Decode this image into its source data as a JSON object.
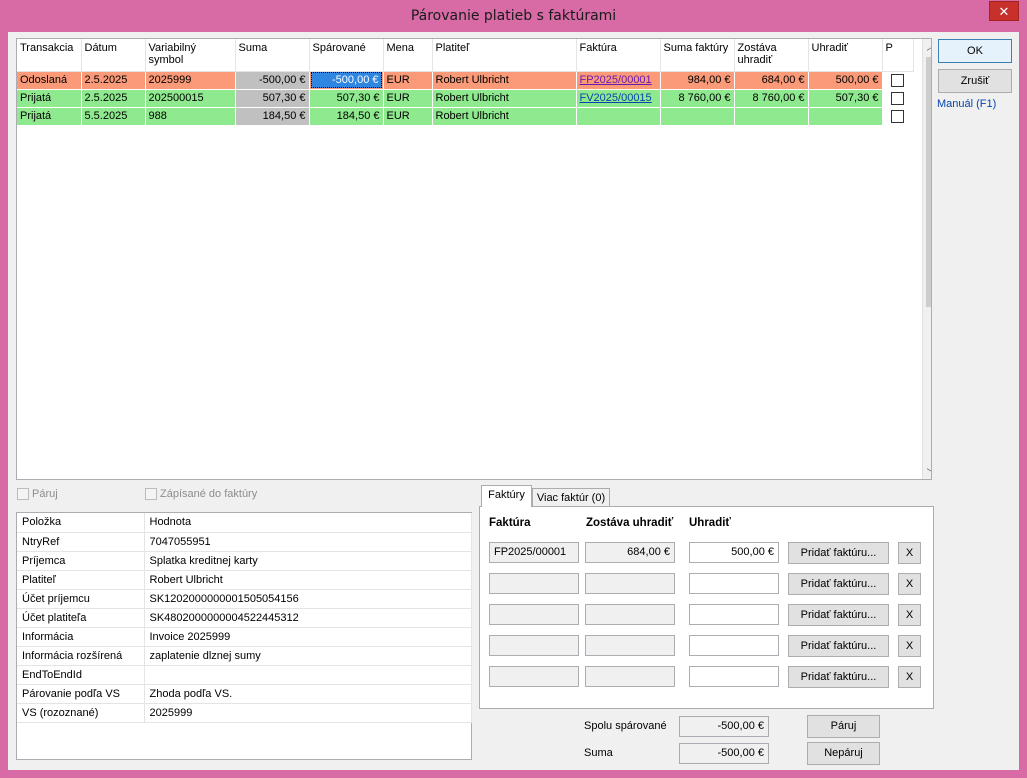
{
  "window": {
    "title": "Párovanie platieb s faktúrami",
    "close_glyph": "✕"
  },
  "grid": {
    "columns": [
      "Transakcia",
      "Dátum",
      "Variabilný symbol",
      "Suma",
      "Spárované",
      "Mena",
      "Platiteľ",
      "Faktúra",
      "Suma faktúry",
      "Zostáva uhradiť",
      "Uhradiť",
      "P"
    ],
    "rows": [
      {
        "type": "Odoslaná",
        "date": "2.5.2025",
        "vs": "2025999",
        "amount": "-500,00 €",
        "paired": "-500,00 €",
        "currency": "EUR",
        "payer": "Robert Ulbricht",
        "invoice": "FP2025/00001",
        "invoice_sum": "984,00 €",
        "remaining": "684,00 €",
        "pay": "500,00 €"
      },
      {
        "type": "Prijatá",
        "date": "2.5.2025",
        "vs": "202500015",
        "amount": "507,30 €",
        "paired": "507,30 €",
        "currency": "EUR",
        "payer": "Robert Ulbricht",
        "invoice": "FV2025/00015",
        "invoice_sum": "8 760,00 €",
        "remaining": "8 760,00 €",
        "pay": "507,30 €"
      },
      {
        "type": "Prijatá",
        "date": "5.5.2025",
        "vs": "988",
        "amount": "184,50 €",
        "paired": "184,50 €",
        "currency": "EUR",
        "payer": "Robert Ulbricht",
        "invoice": "",
        "invoice_sum": "",
        "remaining": "",
        "pay": ""
      }
    ]
  },
  "buttons": {
    "ok": "OK",
    "cancel": "Zrušiť",
    "manual": "Manuál (F1)"
  },
  "checks": {
    "pair": "Páruj",
    "written": "Zápísané do faktúry"
  },
  "details": {
    "headers": [
      "Položka",
      "Hodnota"
    ],
    "rows": [
      [
        "NtryRef",
        "7047055951"
      ],
      [
        "Príjemca",
        "Splatka kreditnej karty"
      ],
      [
        "Platiteľ",
        "Robert Ulbricht"
      ],
      [
        "Účet príjemcu",
        "SK1202000000001505054156"
      ],
      [
        "Účet platiteľa",
        "SK4802000000004522445312"
      ],
      [
        "Informácia",
        "Invoice 2025999"
      ],
      [
        "Informácia rozšírená",
        "zaplatenie dlznej sumy"
      ],
      [
        "EndToEndId",
        ""
      ],
      [
        "Párovanie podľa VS",
        "Zhoda podľa VS."
      ],
      [
        "VS (rozoznané)",
        "2025999"
      ]
    ]
  },
  "tabs": {
    "invoices": "Faktúry",
    "more": "Viac faktúr (0)"
  },
  "invoice_panel": {
    "headers": {
      "invoice": "Faktúra",
      "remaining": "Zostáva uhradiť",
      "pay": "Uhradiť"
    },
    "add_label": "Pridať faktúru...",
    "remove_label": "X",
    "rows": [
      {
        "invoice": "FP2025/00001",
        "remaining": "684,00 €",
        "pay": "500,00 €"
      },
      {
        "invoice": "",
        "remaining": "",
        "pay": ""
      },
      {
        "invoice": "",
        "remaining": "",
        "pay": ""
      },
      {
        "invoice": "",
        "remaining": "",
        "pay": ""
      },
      {
        "invoice": "",
        "remaining": "",
        "pay": ""
      }
    ]
  },
  "summary": {
    "total_paired_label": "Spolu spárované",
    "total_paired": "-500,00 €",
    "sum_label": "Suma",
    "sum": "-500,00 €",
    "pair_btn": "Páruj",
    "unpair_btn": "Nepáruj"
  }
}
